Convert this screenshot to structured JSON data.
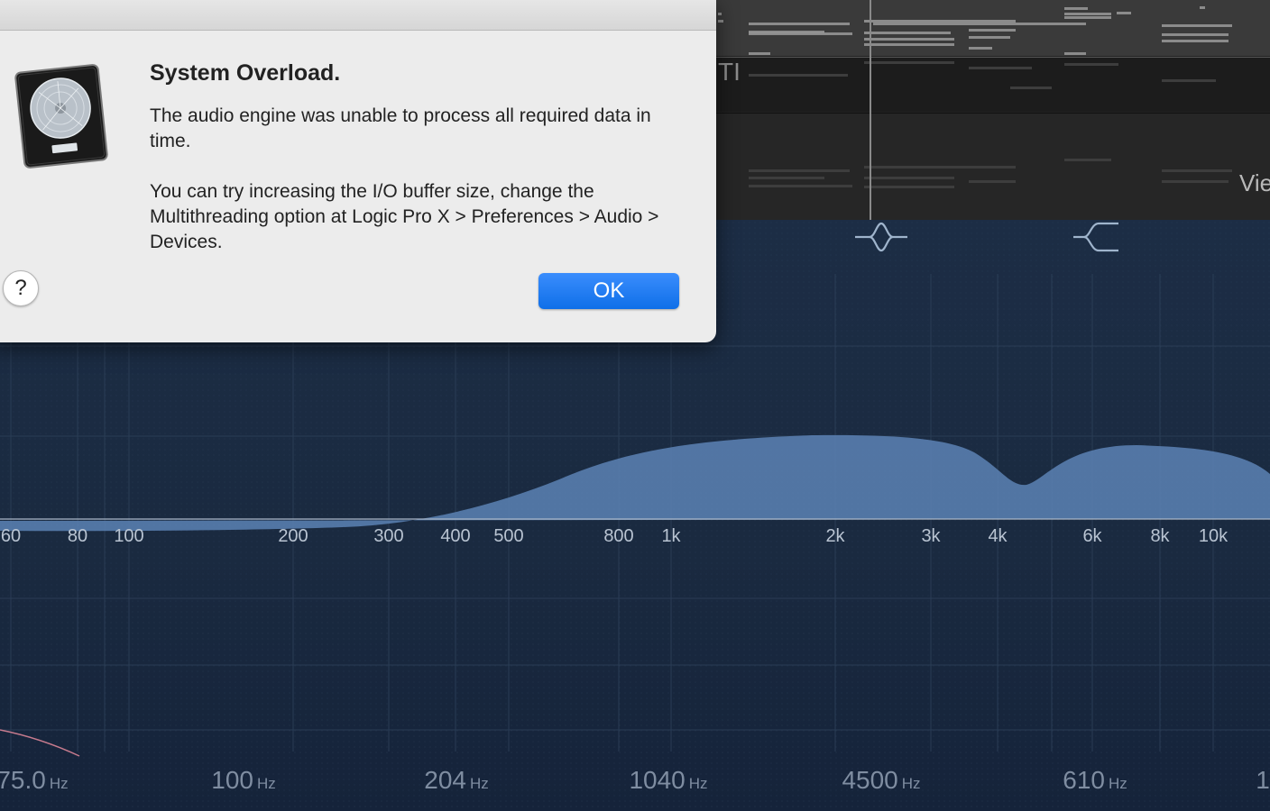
{
  "dialog": {
    "title": "System Overload.",
    "message_1": "The audio engine was unable to process all required data in time.",
    "message_2": "You can try increasing the I/O buffer size, change the Multithreading option at Logic Pro X > Preferences > Audio > Devices.",
    "ok_label": "OK",
    "help_label": "?",
    "icon": "logic-pro-app-icon"
  },
  "tracks": {
    "partial_name": "TI",
    "view_label": "Vie"
  },
  "eq": {
    "freq_axis": [
      "60",
      "80",
      "100",
      "200",
      "300",
      "400",
      "500",
      "800",
      "1k",
      "2k",
      "3k",
      "4k",
      "6k",
      "8k",
      "10k"
    ],
    "band_icons": [
      "bell-band-icon",
      "high-shelf-band-icon"
    ],
    "band_readouts": [
      {
        "value": "75.0",
        "unit": "Hz"
      },
      {
        "value": "100",
        "unit": "Hz"
      },
      {
        "value": "204",
        "unit": "Hz"
      },
      {
        "value": "1040",
        "unit": "Hz"
      },
      {
        "value": "4500",
        "unit": "Hz"
      },
      {
        "value": "610",
        "unit": "Hz"
      },
      {
        "value": "1",
        "unit": ""
      }
    ],
    "curve_color": "#5c83b5",
    "grid_color": "#2c3f58"
  }
}
